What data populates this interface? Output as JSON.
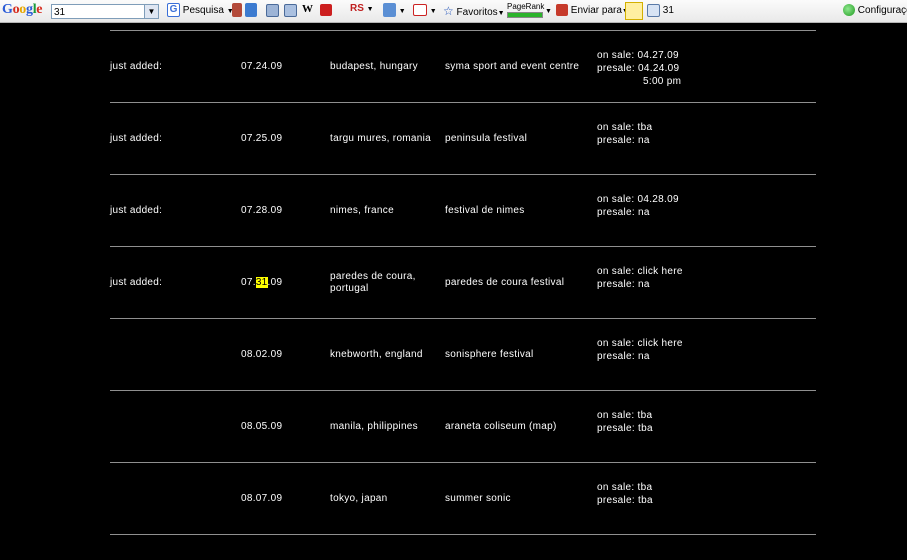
{
  "toolbar": {
    "search_value": "31",
    "pesquisa": "Pesquisa",
    "favoritos": "Favoritos",
    "pagerank": "PageRank",
    "enviar": "Enviar para",
    "count": "31",
    "config": "Configurações"
  },
  "rows": [
    {
      "status": "just added:",
      "date_pre": "07.24.09",
      "date_hl": "",
      "date_post": "",
      "city": "budapest, hungary",
      "venue": "syma sport and event centre",
      "onsale": "on sale: 04.27.09",
      "presale": "presale: 04.24.09",
      "presale2": "5:00 pm"
    },
    {
      "status": "just added:",
      "date_pre": "07.25.09",
      "date_hl": "",
      "date_post": "",
      "city": "targu mures, romania",
      "venue": "peninsula festival",
      "onsale": "on sale: tba",
      "presale": "presale: na",
      "presale2": ""
    },
    {
      "status": "just added:",
      "date_pre": "07.28.09",
      "date_hl": "",
      "date_post": "",
      "city": "nimes, france",
      "venue": "festival de nimes",
      "onsale": "on sale: 04.28.09",
      "presale": "presale: na",
      "presale2": ""
    },
    {
      "status": "just added:",
      "date_pre": "07.",
      "date_hl": "31",
      "date_post": ".09",
      "city": "paredes de coura, portugal",
      "venue": "paredes de coura festival",
      "onsale": "on sale: click here",
      "presale": "presale: na",
      "presale2": ""
    },
    {
      "status": "",
      "date_pre": "08.02.09",
      "date_hl": "",
      "date_post": "",
      "city": "knebworth, england",
      "venue": "sonisphere festival",
      "onsale": "on sale: click here",
      "presale": "presale: na",
      "presale2": ""
    },
    {
      "status": "",
      "date_pre": "08.05.09",
      "date_hl": "",
      "date_post": "",
      "city": "manila, philippines",
      "venue": "araneta coliseum (map)",
      "onsale": "on sale: tba",
      "presale": "presale: tba",
      "presale2": ""
    },
    {
      "status": "",
      "date_pre": "08.07.09",
      "date_hl": "",
      "date_post": "",
      "city": "tokyo, japan",
      "venue": "summer sonic",
      "onsale": "on sale: tba",
      "presale": "presale: tba",
      "presale2": ""
    }
  ]
}
